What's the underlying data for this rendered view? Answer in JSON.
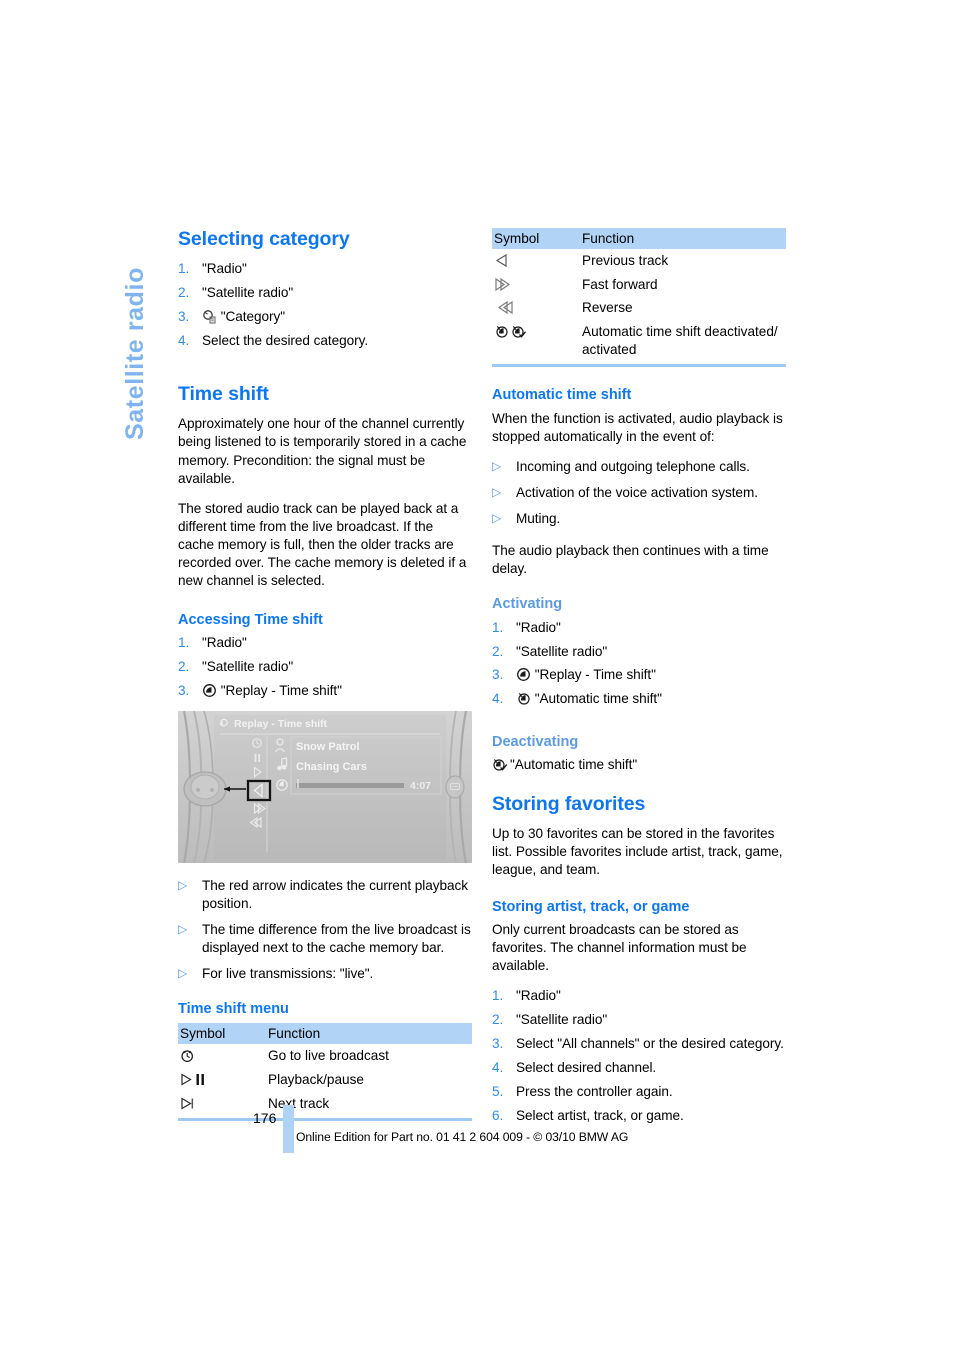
{
  "page": {
    "tab_label": "Satellite radio",
    "page_number": "176",
    "footer_text": "Online Edition for Part no. 01 41 2 604 009 - © 03/10 BMW AG"
  },
  "left_column": {
    "selecting_category": {
      "heading": "Selecting category",
      "steps": [
        {
          "num": "1.",
          "text": "\"Radio\""
        },
        {
          "num": "2.",
          "text": "\"Satellite radio\""
        },
        {
          "num": "3.",
          "icon": "category-icon",
          "text": "\"Category\""
        },
        {
          "num": "4.",
          "text": "Select the desired category."
        }
      ]
    },
    "time_shift": {
      "heading": "Time shift",
      "paragraphs": [
        "Approximately one hour of the channel currently being listened to is temporarily stored in a cache memory. Precondition: the signal must be available.",
        "The stored audio track can be played back at a different time from the live broadcast. If the cache memory is full, then the older tracks are recorded over. The cache memory is deleted if a new channel is selected."
      ]
    },
    "accessing_time_shift": {
      "heading": "Accessing Time shift",
      "steps": [
        {
          "num": "1.",
          "text": "\"Radio\""
        },
        {
          "num": "2.",
          "text": "\"Satellite radio\""
        },
        {
          "num": "3.",
          "icon": "replay-icon",
          "text": "\"Replay - Time shift\""
        }
      ]
    },
    "screenshot": {
      "title": "Replay - Time shift",
      "artist": "Snow Patrol",
      "track": "Chasing Cars",
      "time": "4:07",
      "menu_icons": [
        "live-clock-icon",
        "pause-icon",
        "play-icon",
        "previous-track-icon",
        "fast-forward-icon",
        "reverse-icon"
      ]
    },
    "screenshot_notes": [
      "The red arrow indicates the current playback position.",
      "The time difference from the live broadcast is displayed next to the cache memory bar.",
      "For live transmissions: \"live\"."
    ],
    "time_shift_menu": {
      "heading": "Time shift menu",
      "columns": [
        "Symbol",
        "Function"
      ],
      "rows": [
        {
          "symbol": "live-clock-icon",
          "function": "Go to live broadcast"
        },
        {
          "symbol": "play-pause-icon",
          "function": "Playback/pause"
        },
        {
          "symbol": "next-track-icon",
          "function": "Next track"
        }
      ]
    }
  },
  "right_column": {
    "symbol_table": {
      "columns": [
        "Symbol",
        "Function"
      ],
      "rows": [
        {
          "symbol": "previous-track-icon",
          "function": "Previous track"
        },
        {
          "symbol": "fast-forward-icon",
          "function": "Fast forward"
        },
        {
          "symbol": "reverse-icon",
          "function": "Reverse"
        },
        {
          "symbol": "auto-time-shift-icon",
          "function": "Automatic time shift deactivated/ activated"
        }
      ]
    },
    "automatic_time_shift": {
      "heading": "Automatic time shift",
      "intro": "When the function is activated, audio playback is stopped automatically in the event of:",
      "bullets": [
        "Incoming and outgoing telephone calls.",
        "Activation of the voice activation system.",
        "Muting."
      ],
      "outro": "The audio playback then continues with a time delay."
    },
    "activating": {
      "heading": "Activating",
      "steps": [
        {
          "num": "1.",
          "text": "\"Radio\""
        },
        {
          "num": "2.",
          "text": "\"Satellite radio\""
        },
        {
          "num": "3.",
          "icon": "replay-icon",
          "text": "\"Replay - Time shift\""
        },
        {
          "num": "4.",
          "icon": "auto-time-shift-off-icon",
          "text": "\"Automatic time shift\""
        }
      ]
    },
    "deactivating": {
      "heading": "Deactivating",
      "icon": "auto-time-shift-on-icon",
      "text": "\"Automatic time shift\""
    },
    "storing_favorites": {
      "heading": "Storing favorites",
      "body": "Up to 30 favorites can be stored in the favorites list. Possible favorites include artist, track, game, league, and team."
    },
    "storing_artist": {
      "heading": "Storing artist, track, or game",
      "body": "Only current broadcasts can be stored as favorites. The channel information must be available.",
      "steps": [
        {
          "num": "1.",
          "text": "\"Radio\""
        },
        {
          "num": "2.",
          "text": "\"Satellite radio\""
        },
        {
          "num": "3.",
          "text": "Select \"All channels\" or the desired category."
        },
        {
          "num": "4.",
          "text": "Select desired channel."
        },
        {
          "num": "5.",
          "text": "Press the controller again."
        },
        {
          "num": "6.",
          "text": "Select artist, track, or game."
        }
      ]
    }
  },
  "colors": {
    "heading_blue": "#0D77F2",
    "subheading_light_blue": "#5C9BE3",
    "tab_blue": "#7FB4EE",
    "table_header_bg": "#B0D3F6",
    "rule_blue": "#9EC9F3",
    "number_blue": "#2E8BF0"
  }
}
